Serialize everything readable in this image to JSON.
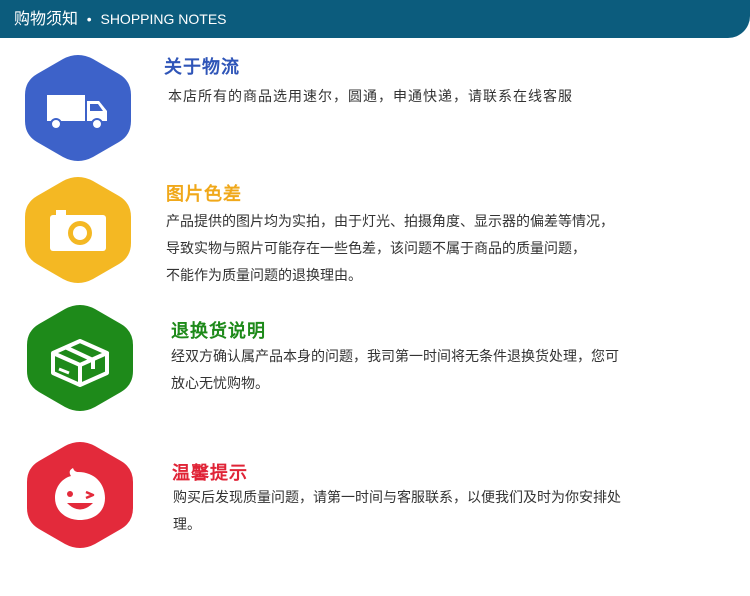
{
  "header": {
    "title_zh": "购物须知",
    "separator": "•",
    "title_en": "SHOPPING NOTES"
  },
  "colors": {
    "header_bg": "#0c5c7d",
    "logistics": "#3d62c9",
    "logistics_title": "#2f55b8",
    "photo": "#f4b823",
    "photo_title": "#f0a81a",
    "return": "#1e8a1a",
    "return_title": "#1e8a1a",
    "tips": "#e32a3b",
    "tips_title": "#e02437"
  },
  "sections": [
    {
      "icon": "truck-icon",
      "title": "关于物流",
      "lines": [
        "本店所有的商品选用速尔，圆通，申通快递，请联系在线客服"
      ]
    },
    {
      "icon": "camera-icon",
      "title": "图片色差",
      "lines": [
        "产品提供的图片均为实拍，由于灯光、拍摄角度、显示器的偏差等情况，",
        "导致实物与照片可能存在一些色差，该问题不属于商品的质量问题，",
        "不能作为质量问题的退换理由。"
      ]
    },
    {
      "icon": "box-icon",
      "title": "退换货说明",
      "lines": [
        "经双方确认属产品本身的问题，我司第一时间将无条件退换货处理，您可",
        "放心无忧购物。"
      ]
    },
    {
      "icon": "smiley-icon",
      "title": "温馨提示",
      "lines": [
        "购买后发现质量问题，请第一时间与客服联系，以便我们及时为你安排处",
        "理。"
      ]
    }
  ]
}
